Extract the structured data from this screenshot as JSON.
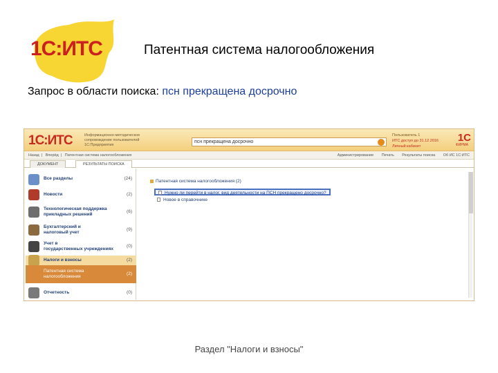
{
  "slide": {
    "logo_text": "1С:ИТС",
    "title": "Патентная система налогообложения",
    "query_label": "Запрос в области поиска:",
    "query_text": "псн прекращена досрочно",
    "caption": "Раздел \"Налоги и взносы\""
  },
  "app": {
    "logo": "1С:ИТС",
    "header_desc": [
      "Информационно-методическое",
      "сопровождение пользователей",
      "1С:Предприятия"
    ],
    "search_value": "псн прекращена досрочно",
    "user_line1": "Пользователь 1",
    "user_line2": "ИТС доступ до 31.12.2016",
    "user_line3": "Личный кабинет",
    "corner_logo": "1С",
    "corner_tag": "ФИРМА",
    "toolbar_left": [
      "Назад",
      "Вперёд",
      "Патентная система налогообложения"
    ],
    "toolbar_right": [
      "Администрирование",
      "Печать",
      "Результаты поиска",
      "Об ИС 1С:ИТС"
    ],
    "tabs": [
      "ДОКУМЕНТ",
      "РЕЗУЛЬТАТЫ ПОИСКА"
    ],
    "sidebar": [
      {
        "label": "Все разделы",
        "count": "(24)"
      },
      {
        "label": "Новости",
        "count": "(2)"
      },
      {
        "label": "Технологическая поддержка прикладных решений",
        "count": "(6)"
      },
      {
        "label": "Бухгалтерский и налоговый учет",
        "count": "(9)"
      },
      {
        "label": "Учет в государственных учреждениях",
        "count": "(0)"
      },
      {
        "label": "Налоги и взносы",
        "count": "(2)"
      },
      {
        "label": "Патентная система налогообложения",
        "count": "(2)"
      },
      {
        "label": "Отчетность",
        "count": "(0)"
      }
    ],
    "results": {
      "group": "Патентная система налогообложения (2)",
      "items": [
        "Нужно ли перейти в налог. вид деятельности на ПСН прекращено досрочно?",
        "Новое в справочнике"
      ]
    }
  },
  "colors": {
    "logo_red": "#c72a1e",
    "logo_yellow": "#f7d533",
    "header_orange": "#f4cf7e",
    "selected_sidebar": "#d8893a",
    "link_blue": "#23407a"
  }
}
